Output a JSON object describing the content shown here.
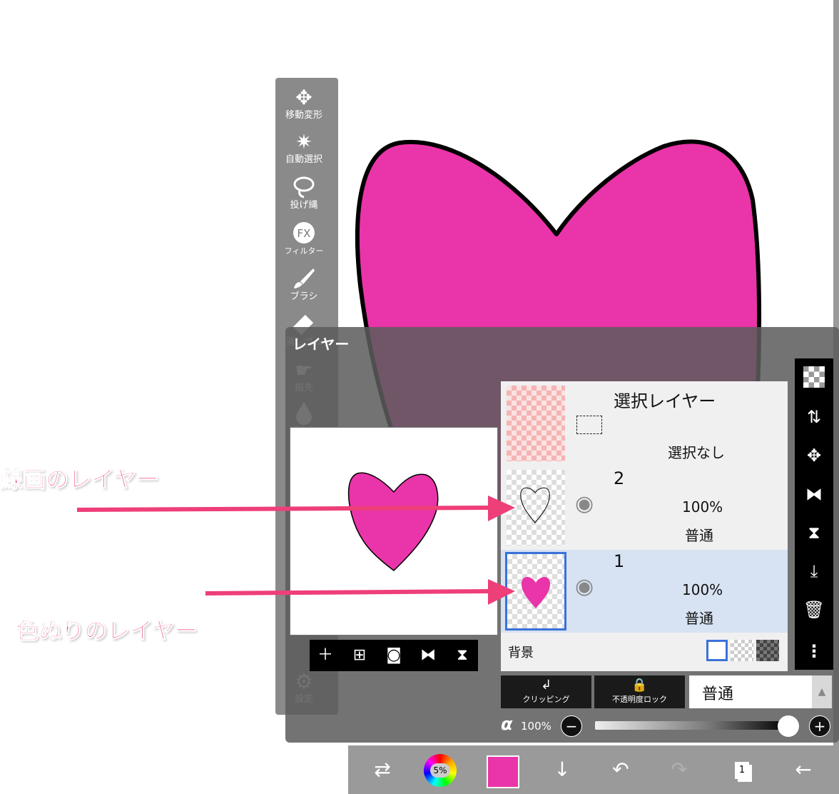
{
  "colors": {
    "accent_pink": "#ea34a9",
    "annotation_pink": "#ee3f78",
    "selected_row_bg": "#d7e2f2",
    "selected_border": "#3a72d8"
  },
  "tool_bar": {
    "tools": [
      {
        "label": "移動変形",
        "icon": "move-icon"
      },
      {
        "label": "自動選択",
        "icon": "magic-wand-icon"
      },
      {
        "label": "投げ縄",
        "icon": "lasso-icon"
      },
      {
        "label": "フィルター",
        "icon": "fx-icon",
        "glyph": "FX"
      },
      {
        "label": "ブラシ",
        "icon": "brush-icon"
      },
      {
        "label": "消しゴム",
        "icon": "eraser-icon"
      },
      {
        "label": "指先",
        "icon": "finger-icon"
      },
      {
        "label": "ぼかし",
        "icon": "drop-icon"
      },
      {
        "label": "設定",
        "icon": "gear-icon"
      }
    ]
  },
  "layer_panel": {
    "title": "レイヤー",
    "selection_layer": {
      "name": "選択レイヤー",
      "status": "選択なし"
    },
    "layers": [
      {
        "name": "2",
        "opacity": "100%",
        "blend": "普通",
        "selected": false
      },
      {
        "name": "1",
        "opacity": "100%",
        "blend": "普通",
        "selected": true
      }
    ],
    "background_label": "背景",
    "clipping_label": "クリッピング",
    "opacity_lock_label": "不透明度ロック",
    "blend_mode": "普通",
    "alpha_symbol": "α",
    "alpha_value": "100%",
    "alpha_level": 1.0
  },
  "bottom_bar": {
    "brush_size": "5%",
    "current_color": "#ea34a9",
    "layer_count": "1"
  },
  "annotations": {
    "line_layer": "線画のレイヤー",
    "color_layer": "色ぬりのレイヤー"
  }
}
